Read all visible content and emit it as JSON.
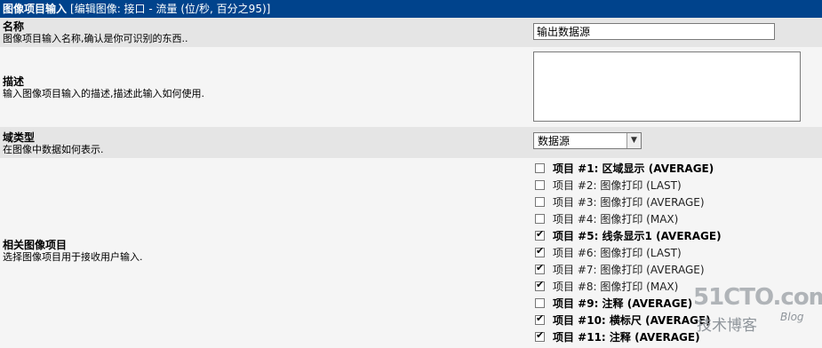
{
  "header": {
    "title": "图像项目输入",
    "subtitle": "[编辑图像: 接口 - 流量 (位/秒, 百分之95)]"
  },
  "name_field": {
    "title": "名称",
    "description": "图像项目输入名称,确认是你可识别的东西..",
    "value": "输出数据源"
  },
  "description_field": {
    "title": "描述",
    "description": "输入图像项目输入的描述,描述此输入如何使用.",
    "value": ""
  },
  "field_type": {
    "title": "域类型",
    "description": "在图像中数据如何表示.",
    "selected": "数据源"
  },
  "related_items": {
    "title": "相关图像项目",
    "description": "选择图像项目用于接收用户输入.",
    "items": [
      {
        "label": "项目 #1: 区域显示 (AVERAGE)",
        "checked": false,
        "bold": true
      },
      {
        "label": "项目 #2: 图像打印 (LAST)",
        "checked": false,
        "bold": false
      },
      {
        "label": "项目 #3: 图像打印 (AVERAGE)",
        "checked": false,
        "bold": false
      },
      {
        "label": "项目 #4: 图像打印 (MAX)",
        "checked": false,
        "bold": false
      },
      {
        "label": "项目 #5: 线条显示1 (AVERAGE)",
        "checked": true,
        "bold": true
      },
      {
        "label": "项目 #6: 图像打印 (LAST)",
        "checked": true,
        "bold": false
      },
      {
        "label": "项目 #7: 图像打印 (AVERAGE)",
        "checked": true,
        "bold": false
      },
      {
        "label": "项目 #8: 图像打印 (MAX)",
        "checked": true,
        "bold": false
      },
      {
        "label": "项目 #9: 注释 (AVERAGE)",
        "checked": false,
        "bold": true
      },
      {
        "label": "项目 #10: 横标尺 (AVERAGE)",
        "checked": true,
        "bold": true
      },
      {
        "label": "项目 #11: 注释 (AVERAGE)",
        "checked": true,
        "bold": true
      }
    ]
  },
  "watermark": {
    "main": "51CTO.com",
    "sub": "技术博客",
    "blog": "Blog"
  }
}
